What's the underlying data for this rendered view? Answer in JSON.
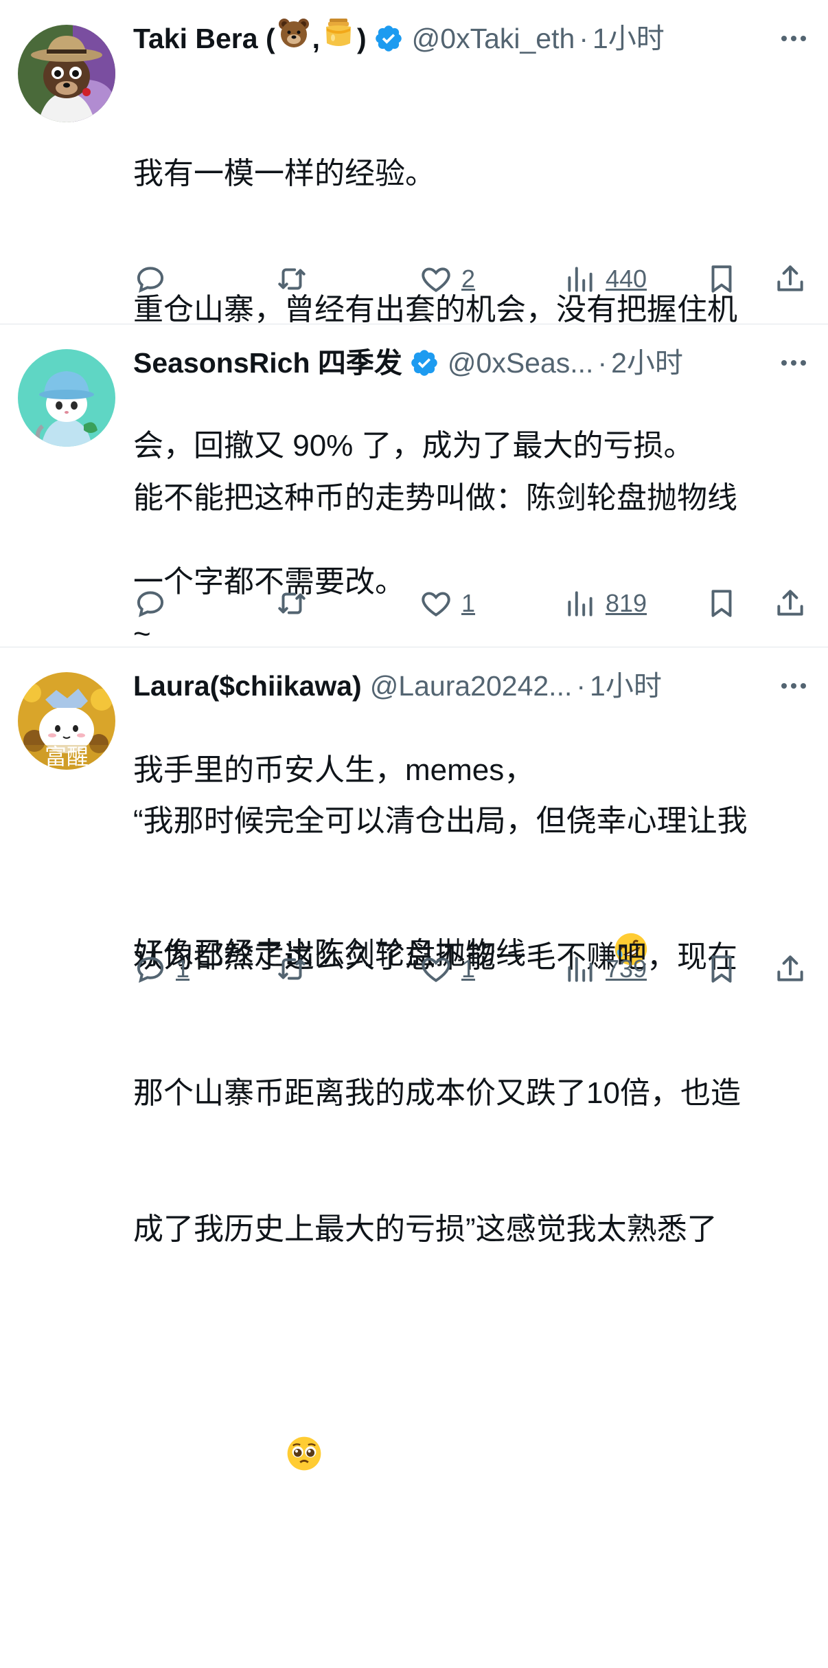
{
  "tweets": [
    {
      "name": "Taki Bera (",
      "name_sep": ",",
      "name_end": ")",
      "name_emojis": [
        "bear-emoji",
        "honey-pot-emoji"
      ],
      "handle": "@0xTaki_eth",
      "dot": "·",
      "time": "1小时",
      "text_lines": [
        "我有一模一样的经验。",
        "重仓山寨，曾经有出套的机会，没有把握住机",
        "会，回撤又 90% 了，成为了最大的亏损。",
        "一个字都不需要改。"
      ],
      "replies": "",
      "likes": "2",
      "views": "440"
    },
    {
      "name": "SeasonsRich 四季发",
      "handle": "@0xSeas...",
      "dot": "·",
      "time": "2小时",
      "text_lines": [
        "能不能把这种币的走势叫做：陈剑轮盘抛物线",
        "~",
        "我手里的币安人生，memes，",
        "好像已经走出陈剑轮盘抛物线"
      ],
      "trailing_emoji": "rolling-laughing-emoji",
      "replies": "",
      "likes": "1",
      "views": "819"
    },
    {
      "name": "Laura($chiikawa)",
      "handle": "@Laura20242...",
      "dot": "·",
      "time": "1小时",
      "avatar_text": "富醒",
      "text_lines": [
        "“我那时候完全可以清仓出局，但侥幸心理让我",
        "认为都熬了这么久了总不能一毛不赚吧，现在",
        "那个山寨币距离我的成本价又跌了10倍，也造",
        "成了我历史上最大的亏损”这感觉我太熟悉了"
      ],
      "trailing_emoji": "pleading-face-emoji",
      "replies": "1",
      "likes": "1",
      "views": "739"
    }
  ],
  "colors": {
    "verified": "#1d9bf0",
    "secondary_text": "#536471",
    "divider": "#e1e6ea"
  }
}
